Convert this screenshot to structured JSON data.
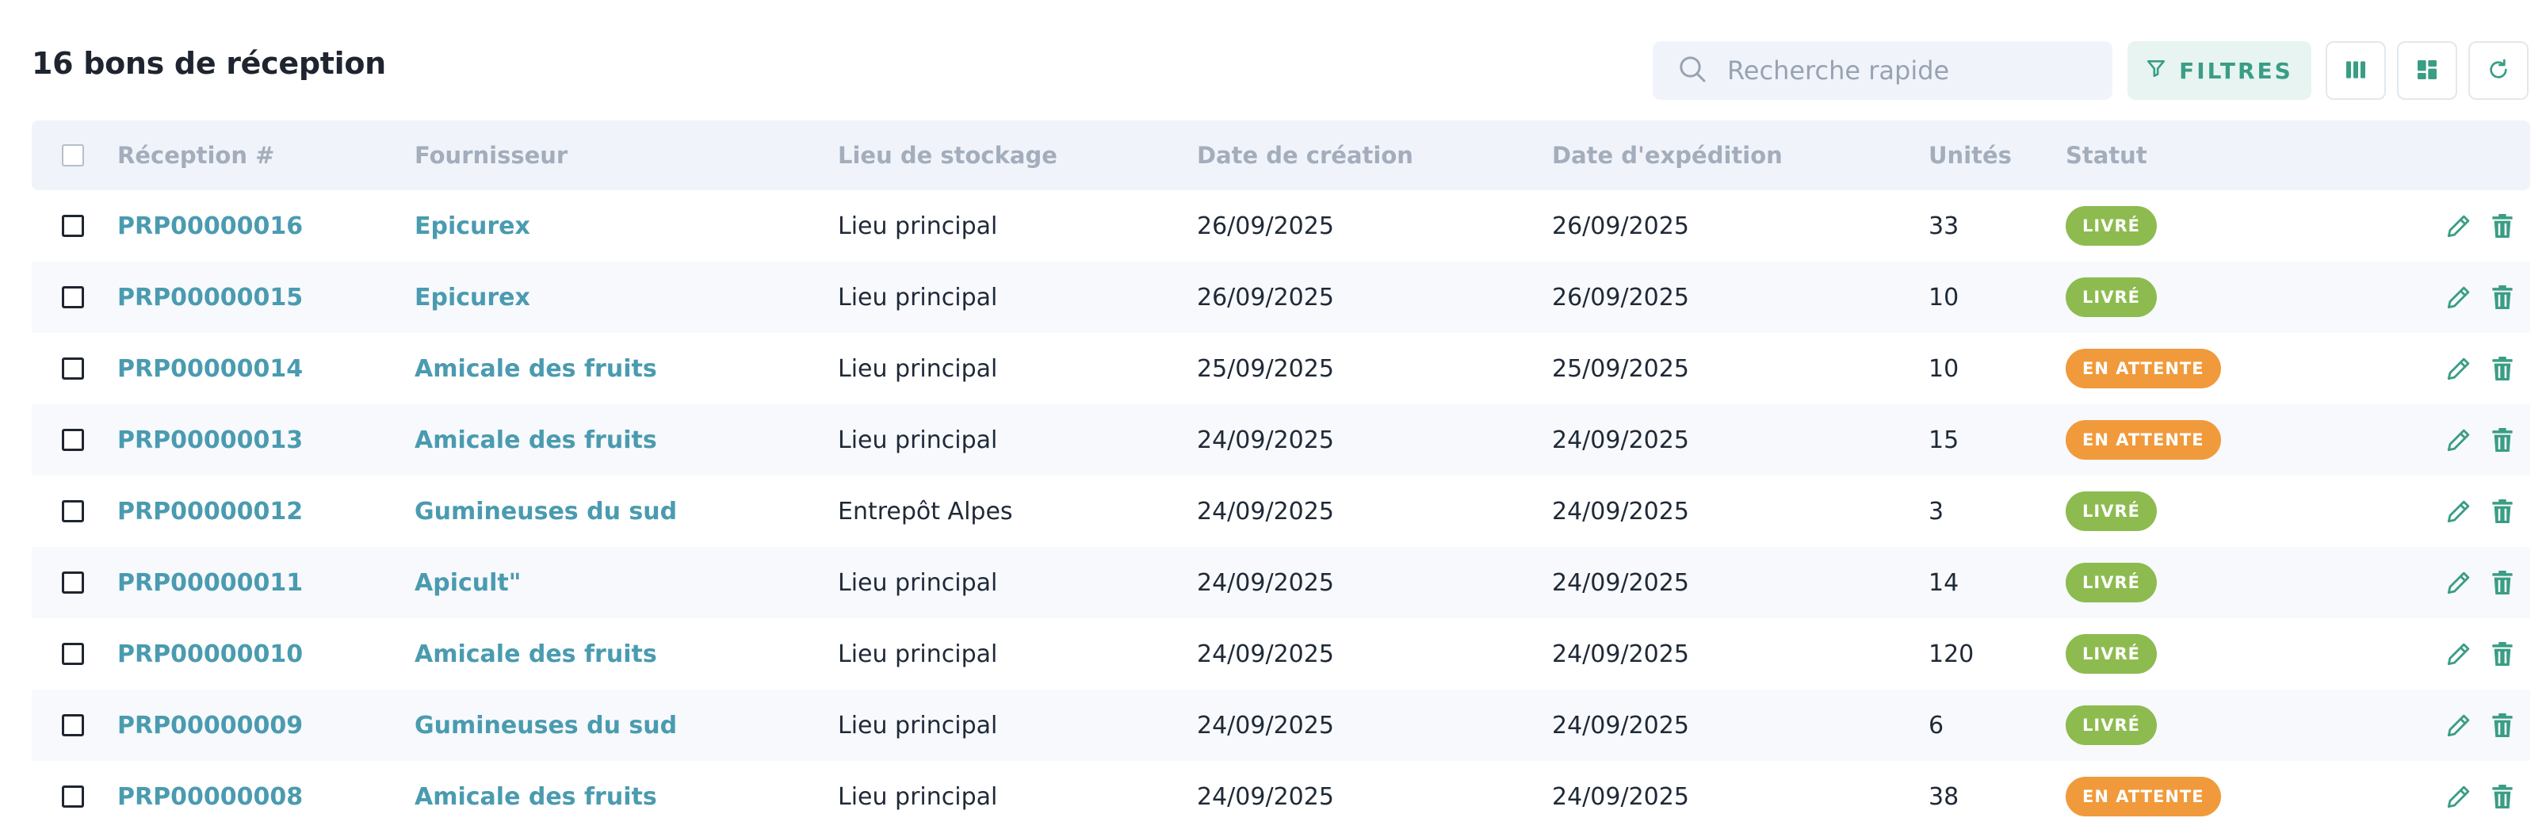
{
  "header": {
    "title": "16 bons de réception",
    "search_placeholder": "Recherche rapide",
    "filters_label": "FILTRES"
  },
  "columns": {
    "reception": "Réception #",
    "fournisseur": "Fournisseur",
    "lieu": "Lieu de stockage",
    "date_creation": "Date de création",
    "date_expedition": "Date d'expédition",
    "unites": "Unités",
    "statut": "Statut"
  },
  "rows": [
    {
      "id": "PRP00000016",
      "fournisseur": "Epicurex",
      "lieu": "Lieu principal",
      "date_creation": "26/09/2025",
      "date_expedition": "26/09/2025",
      "unites": "33",
      "statut": "LIVRÉ",
      "tone": "green"
    },
    {
      "id": "PRP00000015",
      "fournisseur": "Epicurex",
      "lieu": "Lieu principal",
      "date_creation": "26/09/2025",
      "date_expedition": "26/09/2025",
      "unites": "10",
      "statut": "LIVRÉ",
      "tone": "green"
    },
    {
      "id": "PRP00000014",
      "fournisseur": "Amicale des fruits",
      "lieu": "Lieu principal",
      "date_creation": "25/09/2025",
      "date_expedition": "25/09/2025",
      "unites": "10",
      "statut": "EN ATTENTE",
      "tone": "orange"
    },
    {
      "id": "PRP00000013",
      "fournisseur": "Amicale des fruits",
      "lieu": "Lieu principal",
      "date_creation": "24/09/2025",
      "date_expedition": "24/09/2025",
      "unites": "15",
      "statut": "EN ATTENTE",
      "tone": "orange"
    },
    {
      "id": "PRP00000012",
      "fournisseur": "Gumineuses du sud",
      "lieu": "Entrepôt Alpes",
      "date_creation": "24/09/2025",
      "date_expedition": "24/09/2025",
      "unites": "3",
      "statut": "LIVRÉ",
      "tone": "green"
    },
    {
      "id": "PRP00000011",
      "fournisseur": "Apicult\"",
      "lieu": "Lieu principal",
      "date_creation": "24/09/2025",
      "date_expedition": "24/09/2025",
      "unites": "14",
      "statut": "LIVRÉ",
      "tone": "green"
    },
    {
      "id": "PRP00000010",
      "fournisseur": "Amicale des fruits",
      "lieu": "Lieu principal",
      "date_creation": "24/09/2025",
      "date_expedition": "24/09/2025",
      "unites": "120",
      "statut": "LIVRÉ",
      "tone": "green"
    },
    {
      "id": "PRP00000009",
      "fournisseur": "Gumineuses du sud",
      "lieu": "Lieu principal",
      "date_creation": "24/09/2025",
      "date_expedition": "24/09/2025",
      "unites": "6",
      "statut": "LIVRÉ",
      "tone": "green"
    },
    {
      "id": "PRP00000008",
      "fournisseur": "Amicale des fruits",
      "lieu": "Lieu principal",
      "date_creation": "24/09/2025",
      "date_expedition": "24/09/2025",
      "unites": "38",
      "statut": "EN ATTENTE",
      "tone": "orange"
    }
  ],
  "colors": {
    "accent": "#3a9d85",
    "link": "#4a9bb0",
    "status_delivered": "#8dbb4f",
    "status_pending": "#f09a3c"
  },
  "icons": {
    "search": "search-icon",
    "filters": "filter-icon",
    "columns": "columns-icon",
    "layout": "dashboard-layout-icon",
    "refresh": "refresh-icon",
    "edit": "pencil-icon",
    "delete": "trash-icon"
  }
}
